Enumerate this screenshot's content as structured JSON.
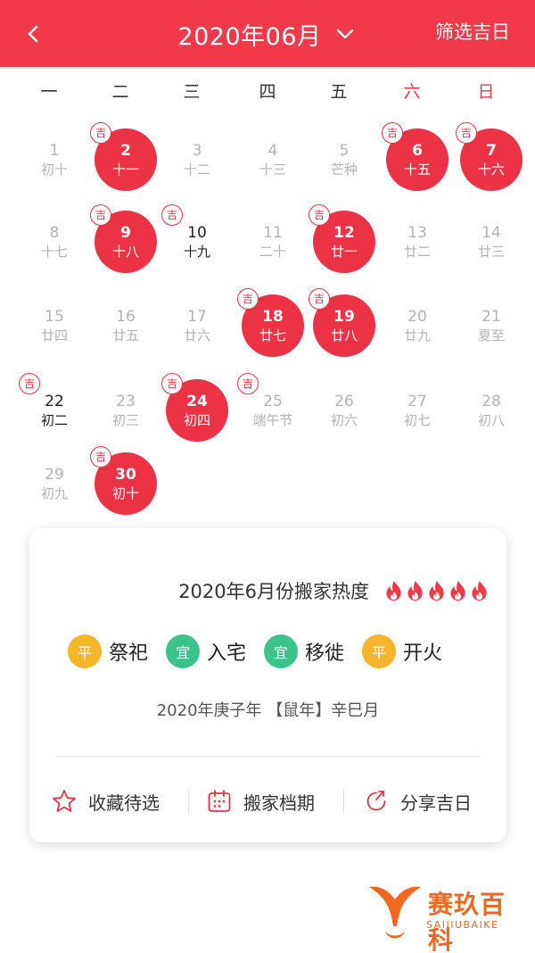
{
  "header": {
    "title": "2020年06月",
    "filter_label": "筛选吉日"
  },
  "weekdays": [
    "一",
    "二",
    "三",
    "四",
    "五",
    "六",
    "日"
  ],
  "lucky_marker": "吉",
  "calendar": {
    "rows": [
      [
        {
          "day": "1",
          "lunar": "初十",
          "state": "normal",
          "ji": false
        },
        {
          "day": "2",
          "lunar": "十一",
          "state": "highlight",
          "ji": true
        },
        {
          "day": "3",
          "lunar": "十二",
          "state": "normal",
          "ji": false
        },
        {
          "day": "4",
          "lunar": "十三",
          "state": "normal",
          "ji": false
        },
        {
          "day": "5",
          "lunar": "芒种",
          "state": "normal",
          "ji": false
        },
        {
          "day": "6",
          "lunar": "十五",
          "state": "highlight",
          "ji": true
        },
        {
          "day": "7",
          "lunar": "十六",
          "state": "highlight",
          "ji": true
        }
      ],
      [
        {
          "day": "8",
          "lunar": "十七",
          "state": "normal",
          "ji": false
        },
        {
          "day": "9",
          "lunar": "十八",
          "state": "highlight",
          "ji": true
        },
        {
          "day": "10",
          "lunar": "十九",
          "state": "dark",
          "ji": true
        },
        {
          "day": "11",
          "lunar": "二十",
          "state": "normal",
          "ji": false
        },
        {
          "day": "12",
          "lunar": "廿一",
          "state": "highlight",
          "ji": true
        },
        {
          "day": "13",
          "lunar": "廿二",
          "state": "normal",
          "ji": false
        },
        {
          "day": "14",
          "lunar": "廿三",
          "state": "normal",
          "ji": false
        }
      ],
      [
        {
          "day": "15",
          "lunar": "廿四",
          "state": "normal",
          "ji": false
        },
        {
          "day": "16",
          "lunar": "廿五",
          "state": "normal",
          "ji": false
        },
        {
          "day": "17",
          "lunar": "廿六",
          "state": "normal",
          "ji": false
        },
        {
          "day": "18",
          "lunar": "廿七",
          "state": "highlight",
          "ji": true
        },
        {
          "day": "19",
          "lunar": "廿八",
          "state": "highlight",
          "ji": true
        },
        {
          "day": "20",
          "lunar": "廿九",
          "state": "normal",
          "ji": false
        },
        {
          "day": "21",
          "lunar": "夏至",
          "state": "normal",
          "ji": false
        }
      ],
      [
        {
          "day": "22",
          "lunar": "初二",
          "state": "dark",
          "ji": true
        },
        {
          "day": "23",
          "lunar": "初三",
          "state": "normal",
          "ji": false
        },
        {
          "day": "24",
          "lunar": "初四",
          "state": "highlight",
          "ji": true
        },
        {
          "day": "25",
          "lunar": "端午节",
          "state": "normal",
          "ji": true
        },
        {
          "day": "26",
          "lunar": "初六",
          "state": "normal",
          "ji": false
        },
        {
          "day": "27",
          "lunar": "初七",
          "state": "normal",
          "ji": false
        },
        {
          "day": "28",
          "lunar": "初八",
          "state": "normal",
          "ji": false
        }
      ],
      [
        {
          "day": "29",
          "lunar": "初九",
          "state": "normal",
          "ji": false
        },
        {
          "day": "30",
          "lunar": "初十",
          "state": "highlight",
          "ji": true
        }
      ]
    ]
  },
  "card": {
    "heat_label": "2020年6月份搬家热度",
    "heat_level": 5,
    "tags": [
      {
        "badge": "平",
        "type": "ping",
        "label": "祭祀"
      },
      {
        "badge": "宜",
        "type": "yi",
        "label": "入宅"
      },
      {
        "badge": "宜",
        "type": "yi",
        "label": "移徙"
      },
      {
        "badge": "平",
        "type": "ping",
        "label": "开火"
      }
    ],
    "ganzhi": "2020年庚子年 【鼠年】辛巳月",
    "actions": {
      "favorite": "收藏待选",
      "schedule": "搬家档期",
      "share": "分享吉日"
    }
  },
  "logo": {
    "cn": "赛玖百科",
    "en": "SAIJIUBAIKE"
  },
  "colors": {
    "primary": "#f2394a",
    "highlight": "#ec3345",
    "ping": "#f7b52c",
    "yi": "#3cc28b",
    "brand": "#f2681e"
  }
}
